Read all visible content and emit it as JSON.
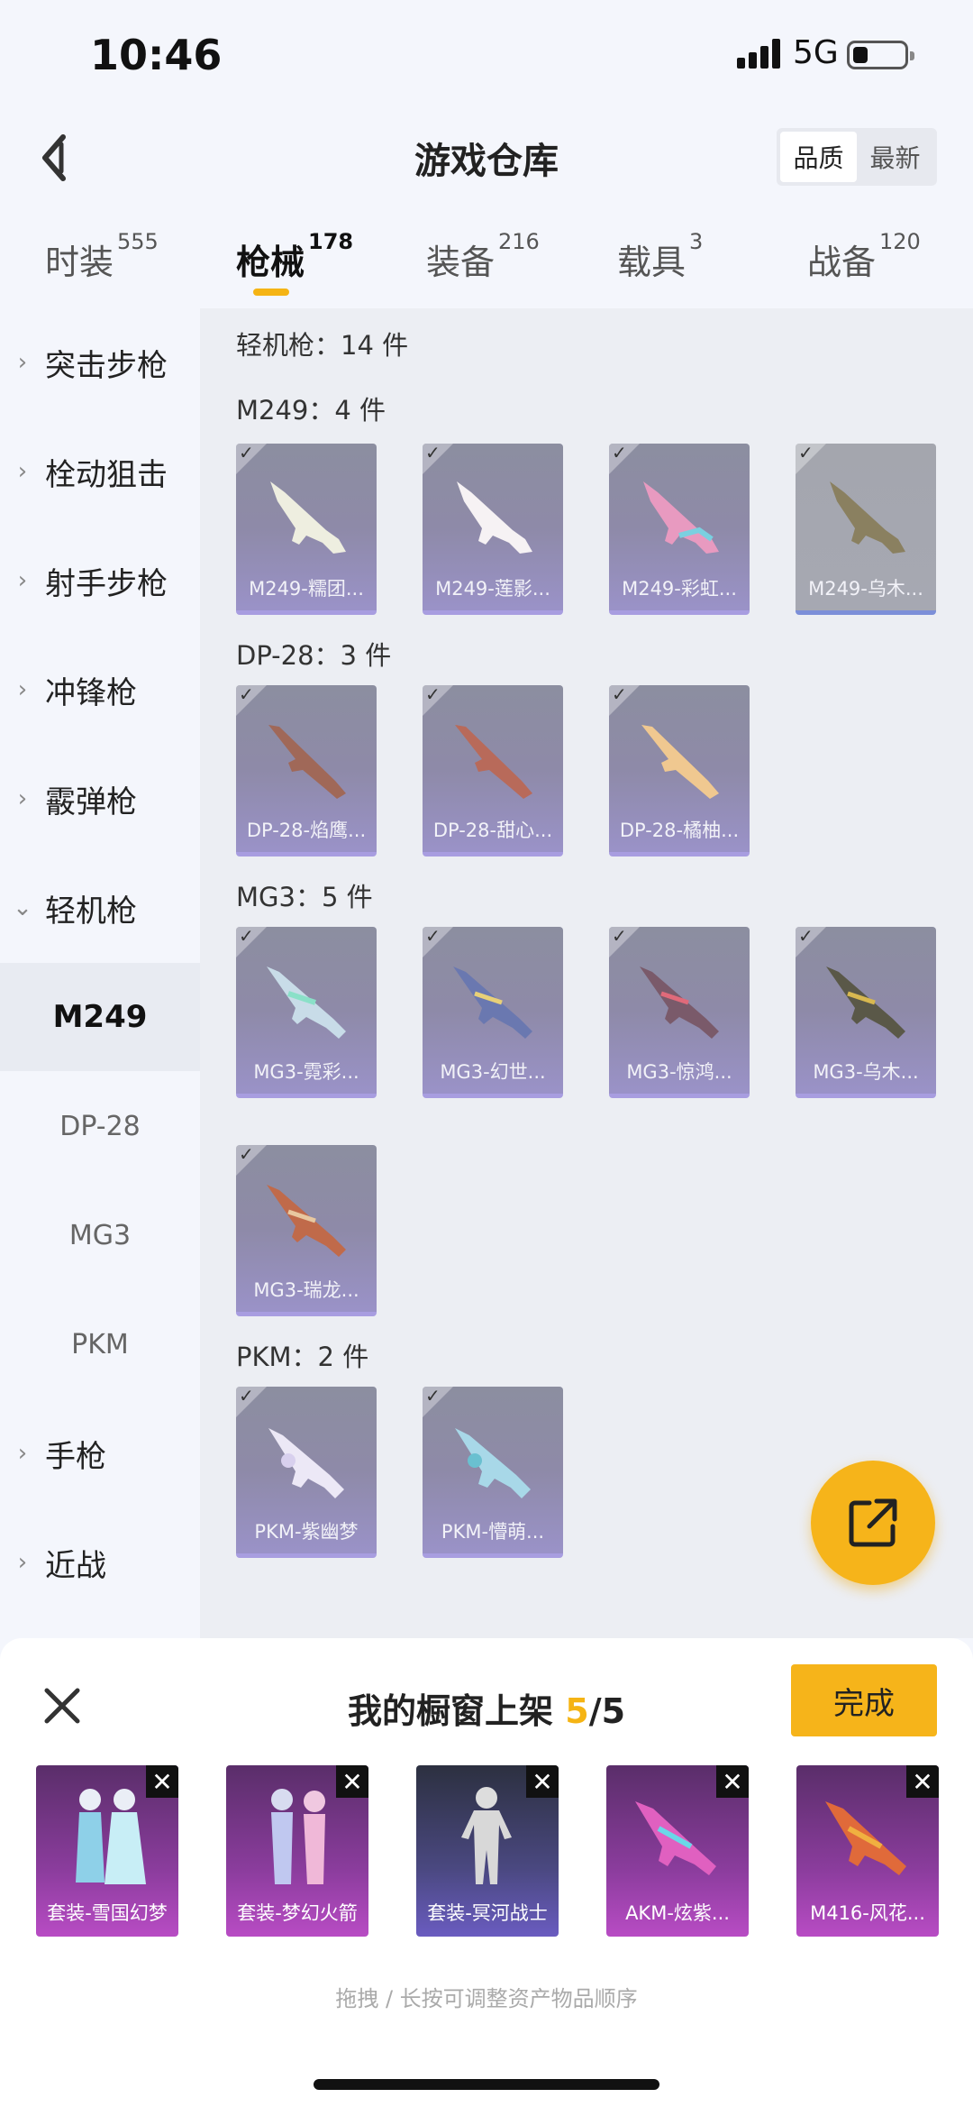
{
  "status": {
    "time": "10:46",
    "network": "5G"
  },
  "header": {
    "title": "游戏仓库",
    "sort": [
      "品质",
      "最新"
    ]
  },
  "tabs": [
    {
      "label": "时装",
      "count": "555"
    },
    {
      "label": "枪械",
      "count": "178"
    },
    {
      "label": "装备",
      "count": "216"
    },
    {
      "label": "载具",
      "count": "3"
    },
    {
      "label": "战备",
      "count": "120"
    }
  ],
  "sidebar": {
    "cats": [
      "突击步枪",
      "栓动狙击",
      "射手步枪",
      "冲锋枪",
      "霰弹枪",
      "轻机枪"
    ],
    "subs": [
      "M249",
      "DP-28",
      "MG3",
      "PKM"
    ],
    "cats2": [
      "手枪",
      "近战"
    ]
  },
  "content": {
    "section_title": "轻机枪：14 件",
    "groups": [
      {
        "title": "M249：4 件",
        "items": [
          "M249-糯团...",
          "M249-莲影...",
          "M249-彩虹...",
          "M249-乌木..."
        ]
      },
      {
        "title": "DP-28：3 件",
        "items": [
          "DP-28-焰鹰...",
          "DP-28-甜心...",
          "DP-28-橘柚..."
        ]
      },
      {
        "title": "MG3：5 件",
        "items": [
          "MG3-霓彩...",
          "MG3-幻世...",
          "MG3-惊鸿...",
          "MG3-乌木...",
          "MG3-瑞龙..."
        ]
      },
      {
        "title": "PKM：2 件",
        "items": [
          "PKM-紫幽梦",
          "PKM-懵萌..."
        ]
      }
    ]
  },
  "panel": {
    "title_prefix": "我的橱窗上架",
    "count": "5",
    "total": "/5",
    "done": "完成",
    "items": [
      "套装-雪国幻梦",
      "套装-梦幻火箭",
      "套装-冥河战士",
      "AKM-炫紫...",
      "M416-风花..."
    ],
    "hint": "拖拽 / 长按可调整资产物品顺序"
  }
}
